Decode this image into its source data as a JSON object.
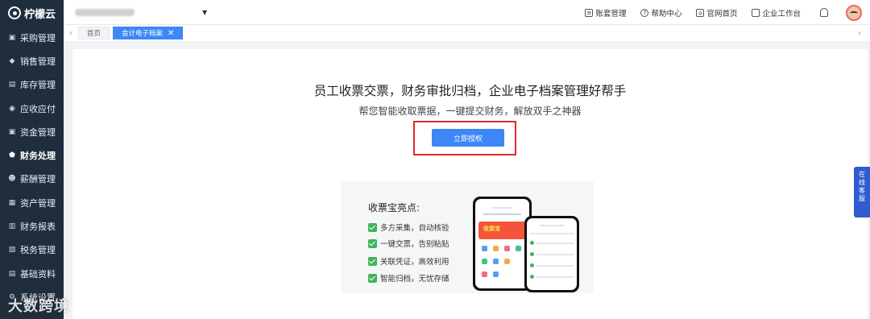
{
  "sidebar": {
    "brand": "柠檬云",
    "items": [
      {
        "label": "采购管理",
        "icon": "cart-icon",
        "glyph": "▣"
      },
      {
        "label": "销售管理",
        "icon": "tag-icon",
        "glyph": "◆"
      },
      {
        "label": "库存管理",
        "icon": "warehouse-icon",
        "glyph": "▤"
      },
      {
        "label": "应收应付",
        "icon": "receivable-icon",
        "glyph": "◉"
      },
      {
        "label": "资金管理",
        "icon": "wallet-icon",
        "glyph": "▣"
      },
      {
        "label": "财务处理",
        "icon": "finance-icon",
        "glyph": "⬟"
      },
      {
        "label": "薪酬管理",
        "icon": "payroll-icon",
        "glyph": "☻"
      },
      {
        "label": "资产管理",
        "icon": "asset-icon",
        "glyph": "▦"
      },
      {
        "label": "财务报表",
        "icon": "report-icon",
        "glyph": "▥"
      },
      {
        "label": "税务管理",
        "icon": "tax-icon",
        "glyph": "▧"
      },
      {
        "label": "基础资料",
        "icon": "database-icon",
        "glyph": "▤"
      },
      {
        "label": "系统设置",
        "icon": "settings-icon",
        "glyph": "⚙"
      }
    ],
    "active_index": 5
  },
  "header": {
    "links": [
      {
        "label": "账套管理",
        "icon": "ledger-icon"
      },
      {
        "label": "帮助中心",
        "icon": "help-icon"
      },
      {
        "label": "官网首页",
        "icon": "home-icon"
      },
      {
        "label": "企业工作台",
        "icon": "monitor-icon"
      }
    ]
  },
  "tabs": [
    {
      "label": "首页",
      "active": false
    },
    {
      "label": "会计电子档案",
      "active": true
    }
  ],
  "main": {
    "headline": "员工收票交票，财务审批归档，企业电子档案管理好帮手",
    "subline": "帮您智能收取票据，一键提交财务，解放双手之神器",
    "auth_button": "立即授权",
    "promo": {
      "title": "收票宝亮点:",
      "features": [
        "多方采集，自动核验",
        "一键交票，告别粘贴",
        "关联凭证，高效利用",
        "智能归档，无忧存储"
      ],
      "banner_text": "收票宝"
    }
  },
  "chat_widget": "在线客服",
  "watermark": "大数跨境",
  "colors": {
    "sidebar": "#1f2d3d",
    "accent": "#3d87f7",
    "highlight": "#e12828",
    "check": "#3fb65a"
  }
}
